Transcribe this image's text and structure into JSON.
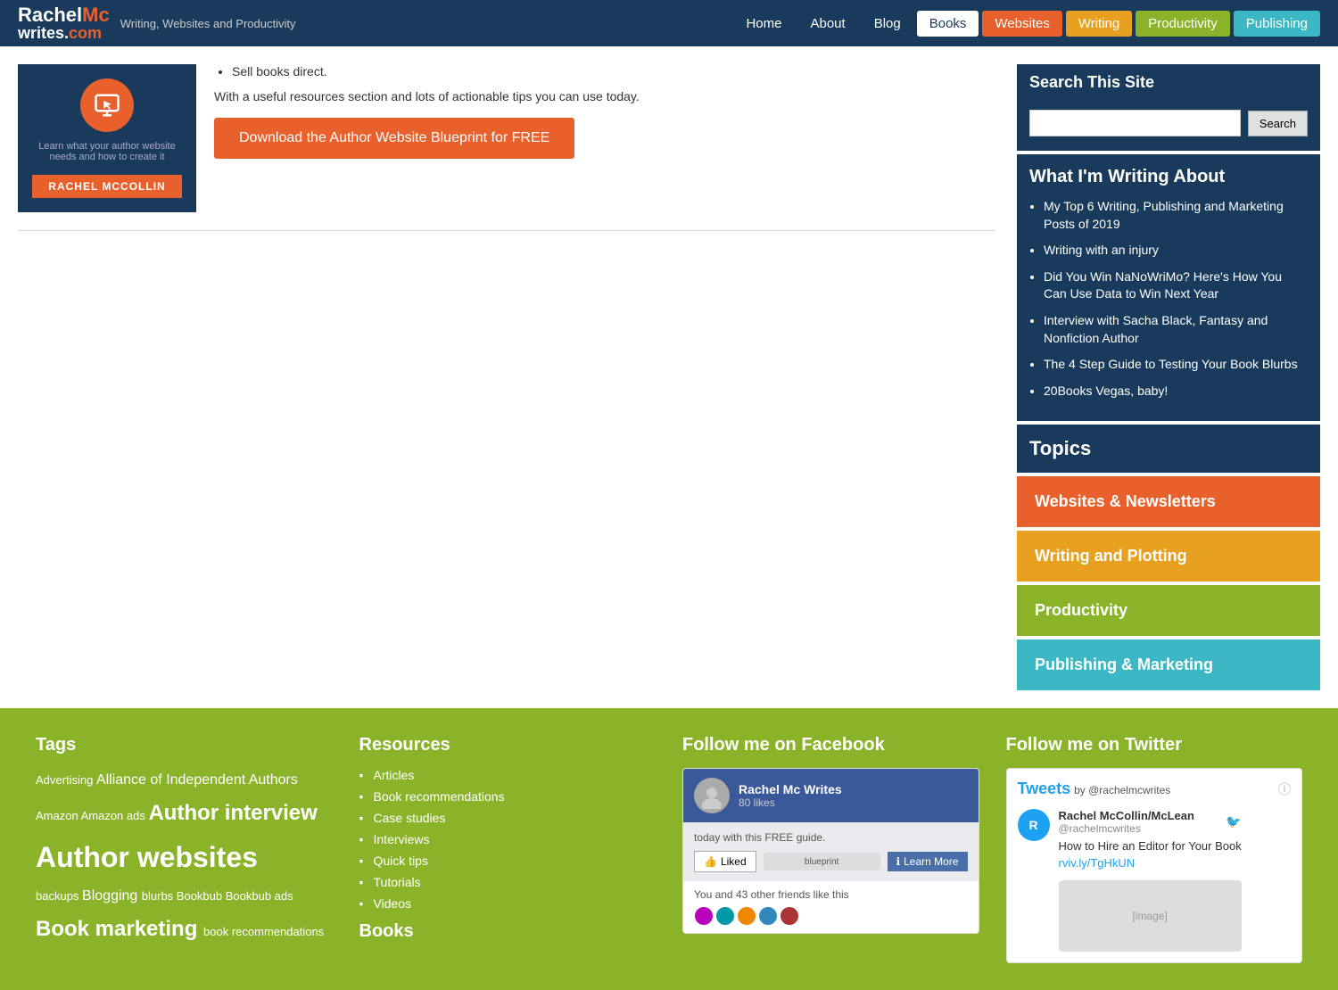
{
  "header": {
    "logo_line1": "RachelMc",
    "logo_line2": "writes.com",
    "logo_highlight": "Mc",
    "tagline": "Writing, Websites and Productivity",
    "nav": [
      {
        "label": "Home",
        "id": "home",
        "class": ""
      },
      {
        "label": "About",
        "id": "about",
        "class": ""
      },
      {
        "label": "Blog",
        "id": "blog",
        "class": ""
      },
      {
        "label": "Books",
        "id": "books",
        "class": "active-books"
      },
      {
        "label": "Websites",
        "id": "websites",
        "class": "tab-websites"
      },
      {
        "label": "Writing",
        "id": "writing",
        "class": "tab-writing"
      },
      {
        "label": "Productivity",
        "id": "productivity",
        "class": "tab-productivity"
      },
      {
        "label": "Publishing",
        "id": "publishing",
        "class": "tab-publishing"
      }
    ]
  },
  "book_promo": {
    "cover_sub_text": "Learn what your author website needs and how to create it",
    "author_name": "RACHEL MCCOLLIN",
    "bullet1": "Sell books direct.",
    "description": "With a useful resources section and lots of actionable tips you can use today.",
    "cta_label": "Download the Author Website Blueprint for FREE"
  },
  "sidebar": {
    "search_title": "Search This Site",
    "search_placeholder": "",
    "search_button": "Search",
    "writing_title": "What I'm Writing About",
    "writing_items": [
      "My Top 6 Writing, Publishing and Marketing Posts of 2019",
      "Writing with an injury",
      "Did You Win NaNoWriMo? Here's How You Can Use Data to Win Next Year",
      "Interview with Sacha Black, Fantasy and Nonfiction Author",
      "The 4 Step Guide to Testing Your Book Blurbs",
      "20Books Vegas, baby!"
    ],
    "topics_title": "Topics",
    "topics": [
      {
        "label": "Websites & Newsletters",
        "class": "topic-btn-red"
      },
      {
        "label": "Writing and Plotting",
        "class": "topic-btn-yellow"
      },
      {
        "label": "Productivity",
        "class": "topic-btn-green"
      },
      {
        "label": "Publishing & Marketing",
        "class": "topic-btn-blue"
      }
    ]
  },
  "footer": {
    "tags_title": "Tags",
    "tags": [
      {
        "text": "Advertising",
        "size": "small"
      },
      {
        "text": "Alliance of Independent Authors",
        "size": "medium"
      },
      {
        "text": "Amazon",
        "size": "small"
      },
      {
        "text": "Amazon ads",
        "size": "small"
      },
      {
        "text": "Author interview",
        "size": "large"
      },
      {
        "text": "Author websites",
        "size": "xlarge"
      },
      {
        "text": "backups",
        "size": "small"
      },
      {
        "text": "Blogging",
        "size": "medium"
      },
      {
        "text": "blurbs",
        "size": "small"
      },
      {
        "text": "Bookbub",
        "size": "small"
      },
      {
        "text": "Bookbub ads",
        "size": "small"
      },
      {
        "text": "Book marketing",
        "size": "large"
      },
      {
        "text": "book recommendations",
        "size": "small"
      }
    ],
    "resources_title": "Resources",
    "resources": [
      "Articles",
      "Book recommendations",
      "Case studies",
      "Interviews",
      "Quick tips",
      "Tutorials",
      "Videos"
    ],
    "books_title": "Books",
    "facebook_title": "Follow me on Facebook",
    "facebook_page": "Rachel Mc Writes",
    "facebook_likes": "80 likes",
    "facebook_guide_text": "today with this FREE guide.",
    "facebook_blueprint": "blueprint",
    "facebook_footer": "You and 43 other friends like this",
    "twitter_title": "Follow me on Twitter",
    "tweets_label": "Tweets",
    "tweets_by": "by @rachelmcwrites",
    "twitter_name": "Rachel McCollin/McLean",
    "twitter_handle": "@rachelmcwrites",
    "tweet_text": "How to Hire an Editor for Your Book",
    "tweet_link": "rviv.ly/TgHkUN"
  }
}
